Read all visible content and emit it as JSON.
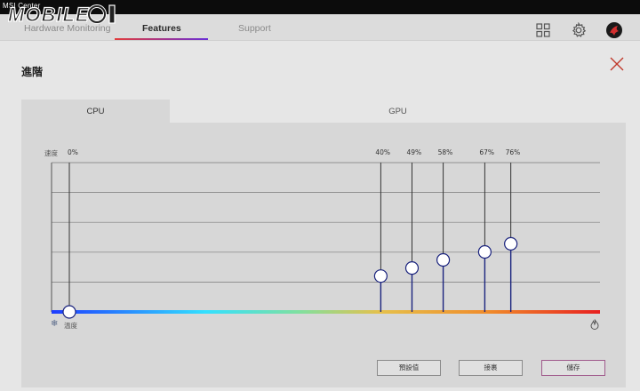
{
  "app": {
    "title": "MSI Center"
  },
  "nav": {
    "tabs": [
      {
        "label": "Hardware Monitoring"
      },
      {
        "label": "Features"
      },
      {
        "label": "Support"
      }
    ]
  },
  "panel": {
    "title": "進階"
  },
  "gpu_tabs": [
    {
      "label": "CPU"
    },
    {
      "label": "GPU"
    }
  ],
  "chart_data": {
    "type": "line",
    "ylabel": "速度",
    "xlabel": "溫度",
    "x": [
      0,
      51,
      57,
      63,
      71,
      76
    ],
    "values": [
      0,
      40,
      49,
      58,
      67,
      76
    ],
    "point_labels": [
      "0%",
      "40%",
      "49%",
      "58%",
      "67%",
      "76%"
    ],
    "ylim": [
      0,
      100
    ],
    "grid": true
  },
  "buttons": {
    "default": "預設值",
    "apply": "接裹",
    "save": "儲存"
  },
  "colors": {
    "accent": "#e23b3b",
    "point_line": "#1a237e"
  }
}
